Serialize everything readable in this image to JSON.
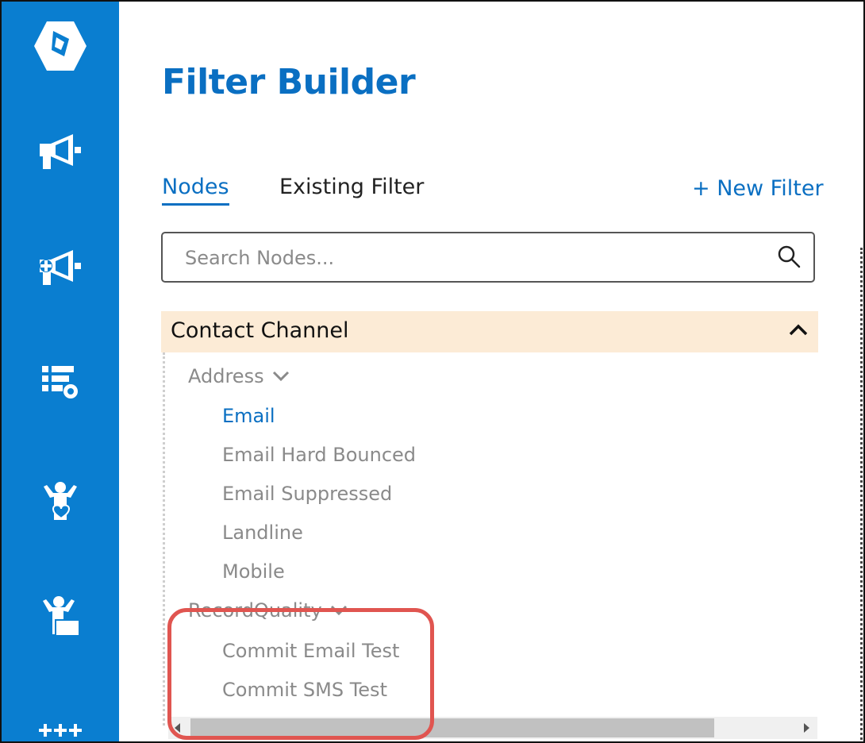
{
  "app": {
    "title": "Filter Builder"
  },
  "sidebar": {
    "items": [
      {
        "icon": "logo-icon"
      },
      {
        "icon": "megaphone-icon"
      },
      {
        "icon": "megaphone-plus-icon"
      },
      {
        "icon": "table-settings-icon"
      },
      {
        "icon": "person-heart-icon"
      },
      {
        "icon": "person-desk-icon"
      },
      {
        "icon": "sparkle-grid-icon"
      }
    ],
    "color": "#0a7ed0"
  },
  "tabs": [
    {
      "label": "Nodes",
      "active": true
    },
    {
      "label": "Existing Filter",
      "active": false
    }
  ],
  "new_filter_label": "+ New Filter",
  "search": {
    "placeholder": "Search Nodes...",
    "value": ""
  },
  "tree": {
    "section": {
      "label": "Contact Channel",
      "expanded": true
    },
    "groups": [
      {
        "label": "Address",
        "items": [
          "Email",
          "Email Hard Bounced",
          "Email Suppressed",
          "Landline",
          "Mobile"
        ],
        "active_item": "Email"
      },
      {
        "label": "RecordQuality",
        "items": [
          "Commit Email Test",
          "Commit SMS Test"
        ]
      }
    ]
  },
  "colors": {
    "accent": "#0a6fc2",
    "section_bg": "#fcebd6",
    "highlight": "#e05550"
  }
}
